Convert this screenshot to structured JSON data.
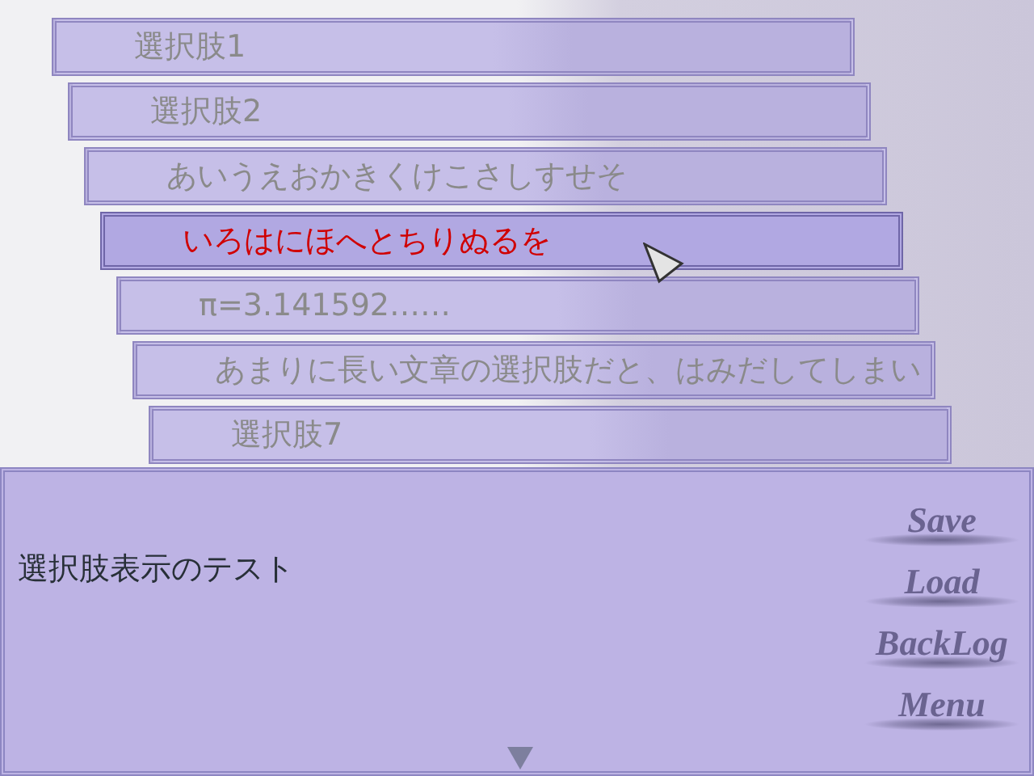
{
  "choices": [
    {
      "text": "選択肢1",
      "selected": false
    },
    {
      "text": "選択肢2",
      "selected": false
    },
    {
      "text": "あいうえおかきくけこさしすせそ",
      "selected": false
    },
    {
      "text": "いろはにほへとちりぬるを",
      "selected": true
    },
    {
      "text": "π=3.141592……",
      "selected": false
    },
    {
      "text": "あまりに長い文章の選択肢だと、はみだしてしまい",
      "selected": false
    },
    {
      "text": "選択肢7",
      "selected": false
    }
  ],
  "message": {
    "text": "選択肢表示のテスト"
  },
  "menu": [
    "Save",
    "Load",
    "BackLog",
    "Menu"
  ]
}
